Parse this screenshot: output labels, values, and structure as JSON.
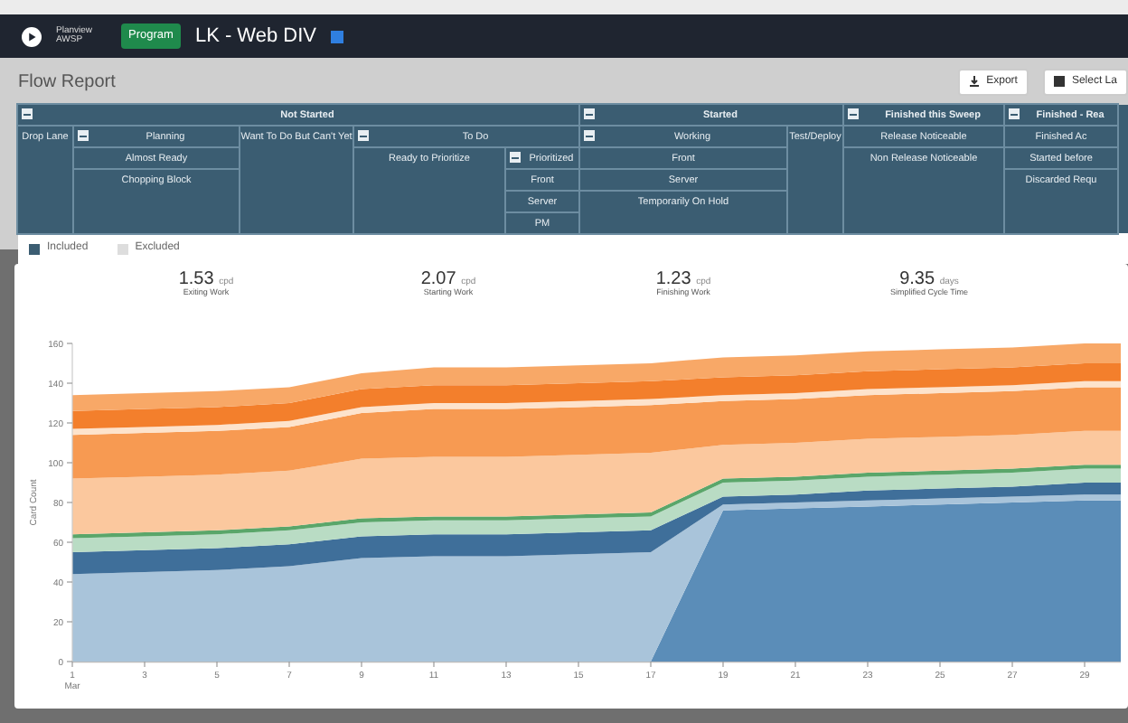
{
  "app_bar": {
    "logo_line_1": "Planview",
    "logo_line_2": "AWSP",
    "badge": "Program",
    "board_title": "LK - Web DIV"
  },
  "page": {
    "title": "Flow Report",
    "buttons": [
      "Export",
      "Select La"
    ]
  },
  "lanes": [
    {
      "label": "Not Started",
      "collapse": true,
      "kind": "group"
    },
    {
      "label": "Started",
      "collapse": true,
      "kind": "group"
    },
    {
      "label": "Finished this Sweep",
      "collapse": true,
      "kind": "group"
    },
    {
      "label": "Finished - Rea",
      "collapse": true,
      "kind": "group"
    },
    {
      "label": "Drop Lane",
      "collapse": false,
      "kind": "lane"
    },
    {
      "label": "Planning",
      "collapse": true,
      "kind": "lane"
    },
    {
      "label": "Want To Do But Can't Yet",
      "collapse": false,
      "kind": "lane"
    },
    {
      "label": "To Do",
      "collapse": true,
      "kind": "lane"
    },
    {
      "label": "Working",
      "collapse": true,
      "kind": "lane"
    },
    {
      "label": "Test/Deploy",
      "collapse": false,
      "kind": "lane"
    },
    {
      "label": "Release Noticeable",
      "collapse": false,
      "kind": "lane"
    },
    {
      "label": "Finished Ac",
      "collapse": false,
      "kind": "lane"
    },
    {
      "label": "Almost Ready",
      "collapse": false,
      "kind": "lane"
    },
    {
      "label": "Ready to Prioritize",
      "collapse": false,
      "kind": "lane"
    },
    {
      "label": "Prioritized",
      "collapse": true,
      "kind": "lane"
    },
    {
      "label": "Front",
      "collapse": false,
      "kind": "lane"
    },
    {
      "label": "Non Release Noticeable",
      "collapse": false,
      "kind": "lane"
    },
    {
      "label": "Started before",
      "collapse": false,
      "kind": "lane"
    },
    {
      "label": "Chopping Block",
      "collapse": false,
      "kind": "lane"
    },
    {
      "label": "Front",
      "collapse": false,
      "kind": "lane"
    },
    {
      "label": "Server",
      "collapse": false,
      "kind": "lane"
    },
    {
      "label": "Discarded Requ",
      "collapse": false,
      "kind": "lane"
    },
    {
      "label": "Server",
      "collapse": false,
      "kind": "lane"
    },
    {
      "label": "Temporarily On Hold",
      "collapse": false,
      "kind": "lane"
    },
    {
      "label": "PM",
      "collapse": false,
      "kind": "lane"
    }
  ],
  "legend": [
    {
      "label": "Included",
      "selected": true
    },
    {
      "label": "Excluded",
      "selected": false
    }
  ],
  "metrics": [
    {
      "value": "1.53",
      "unit": "cpd",
      "label": "Exiting Work"
    },
    {
      "value": "2.07",
      "unit": "cpd",
      "label": "Starting Work"
    },
    {
      "value": "1.23",
      "unit": "cpd",
      "label": "Finishing Work"
    },
    {
      "value": "9.35",
      "unit": "days",
      "label": "Simplified Cycle Time"
    }
  ],
  "chart_data": {
    "type": "area",
    "stacked": true,
    "ylabel": "Card Count",
    "x": [
      1,
      3,
      5,
      7,
      9,
      11,
      13,
      15,
      17,
      19,
      21,
      23,
      25,
      27,
      29,
      30
    ],
    "xlim": [
      1,
      30
    ],
    "ylim": [
      0,
      160
    ],
    "yticks": [
      0,
      20,
      40,
      60,
      80,
      100,
      120,
      140,
      160
    ],
    "xticks": [
      {
        "value": 1,
        "label": "1 Mar"
      },
      3,
      5,
      7,
      9,
      11,
      13,
      15,
      17,
      19,
      21,
      23,
      25,
      27,
      29
    ],
    "series": [
      {
        "color": "#5b8db8",
        "values": [
          0,
          0,
          0,
          0,
          0,
          0,
          0,
          0,
          0,
          76,
          77,
          78,
          79,
          80,
          81,
          81
        ]
      },
      {
        "color": "#a9c4da",
        "values": [
          44,
          45,
          46,
          48,
          52,
          53,
          53,
          54,
          55,
          3,
          3,
          3,
          3,
          3,
          3,
          3
        ]
      },
      {
        "color": "#3f6f9a",
        "values": [
          11,
          11,
          11,
          11,
          11,
          11,
          11,
          11,
          11,
          4,
          4,
          5,
          5,
          5,
          6,
          6
        ]
      },
      {
        "color": "#b9dcc4",
        "values": [
          7,
          7,
          7,
          7,
          7,
          7,
          7,
          7,
          7,
          7,
          7,
          7,
          7,
          7,
          7,
          7
        ]
      },
      {
        "color": "#5aa66a",
        "values": [
          2,
          2,
          2,
          2,
          2,
          2,
          2,
          2,
          2,
          2,
          2,
          2,
          2,
          2,
          2,
          2
        ]
      },
      {
        "color": "#fbc89e",
        "values": [
          28,
          28,
          28,
          28,
          30,
          30,
          30,
          30,
          30,
          17,
          17,
          17,
          17,
          17,
          17,
          17
        ]
      },
      {
        "color": "#f79a52",
        "values": [
          22,
          22,
          22,
          22,
          23,
          24,
          24,
          24,
          24,
          22,
          22,
          22,
          22,
          22,
          22,
          22
        ]
      },
      {
        "color": "#fde3cc",
        "values": [
          3,
          3,
          3,
          3,
          3,
          3,
          3,
          3,
          3,
          3,
          3,
          3,
          3,
          3,
          3,
          3
        ]
      },
      {
        "color": "#f37f2c",
        "values": [
          9,
          9,
          9,
          9,
          9,
          9,
          9,
          9,
          9,
          9,
          9,
          9,
          9,
          9,
          9,
          9
        ]
      },
      {
        "color": "#f8a867",
        "values": [
          8,
          8,
          8,
          8,
          8,
          9,
          9,
          9,
          9,
          10,
          10,
          10,
          10,
          10,
          10,
          10
        ]
      }
    ]
  }
}
